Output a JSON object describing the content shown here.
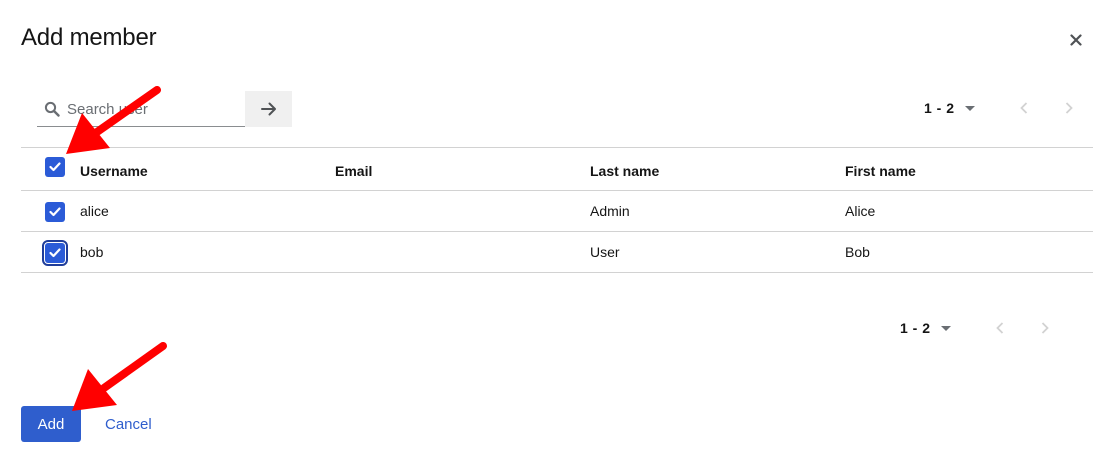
{
  "modal": {
    "title": "Add member",
    "close_icon": "close-icon"
  },
  "search": {
    "placeholder": "Search user",
    "value": "",
    "icon": "search-icon",
    "submit_icon": "arrow-right-icon"
  },
  "pagination_top": {
    "range": "1 - 2"
  },
  "pagination_bottom": {
    "range": "1 - 2"
  },
  "table": {
    "select_all_checked": true,
    "columns": [
      "Username",
      "Email",
      "Last name",
      "First name"
    ],
    "rows": [
      {
        "checked": true,
        "username": "alice",
        "email": "",
        "last_name": "Admin",
        "first_name": "Alice"
      },
      {
        "checked": true,
        "username": "bob",
        "email": "",
        "last_name": "User",
        "first_name": "Bob"
      }
    ]
  },
  "footer": {
    "add_label": "Add",
    "cancel_label": "Cancel"
  },
  "colors": {
    "primary": "#2f5ecd",
    "annotation_arrow": "#ff0000"
  }
}
